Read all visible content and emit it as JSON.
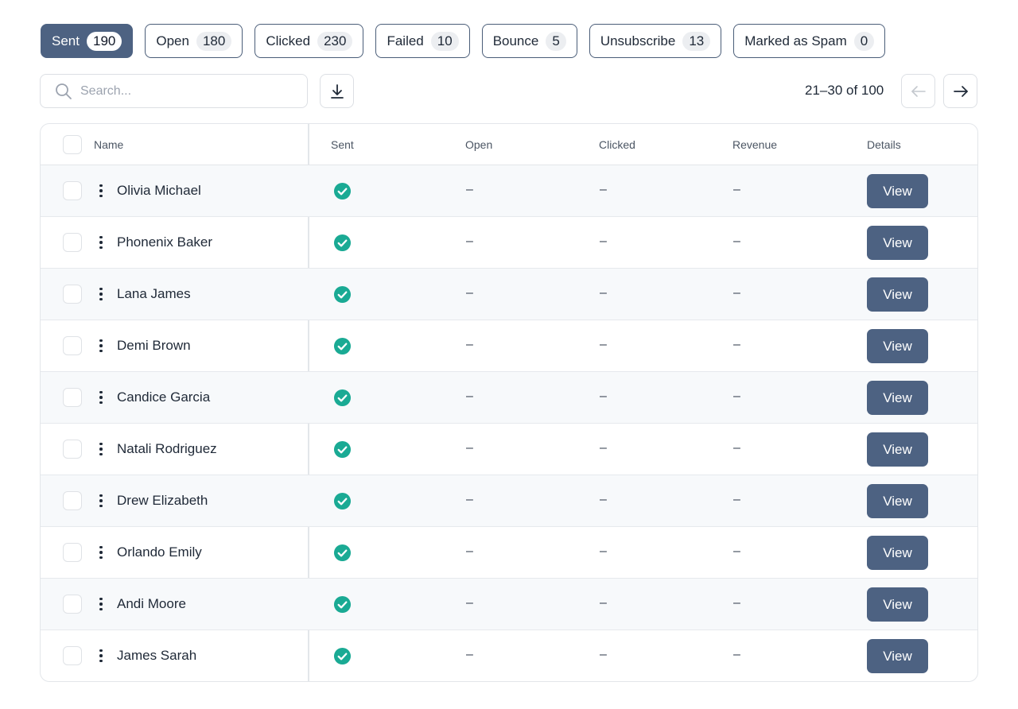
{
  "filters": [
    {
      "label": "Sent",
      "count": "190",
      "active": true
    },
    {
      "label": "Open",
      "count": "180"
    },
    {
      "label": "Clicked",
      "count": "230"
    },
    {
      "label": "Failed",
      "count": "10"
    },
    {
      "label": "Bounce",
      "count": "5"
    },
    {
      "label": "Unsubscribe",
      "count": "13"
    },
    {
      "label": "Marked as Spam",
      "count": "0"
    }
  ],
  "search": {
    "placeholder": "Search...",
    "value": "",
    "icon": "search-icon"
  },
  "toolbar": {
    "download_icon": "download-icon"
  },
  "pagination": {
    "range": "21–30 of 100",
    "prev_icon": "arrow-left-icon",
    "next_icon": "arrow-right-icon",
    "prev_disabled": true
  },
  "table": {
    "columns": [
      "Name",
      "Sent",
      "Open",
      "Clicked",
      "Revenue",
      "Details"
    ],
    "view_label": "View",
    "empty_value": "–",
    "sent_icon": "check-circle-icon",
    "colors": {
      "sent_check": "#1aaa94",
      "accent": "#4d6282"
    },
    "rows": [
      {
        "name": "Olivia Michael",
        "sent": true,
        "open": "–",
        "clicked": "–",
        "revenue": "–"
      },
      {
        "name": "Phonenix Baker",
        "sent": true,
        "open": "–",
        "clicked": "–",
        "revenue": "–"
      },
      {
        "name": "Lana James",
        "sent": true,
        "open": "–",
        "clicked": "–",
        "revenue": "–"
      },
      {
        "name": "Demi Brown",
        "sent": true,
        "open": "–",
        "clicked": "–",
        "revenue": "–"
      },
      {
        "name": "Candice Garcia",
        "sent": true,
        "open": "–",
        "clicked": "–",
        "revenue": "–"
      },
      {
        "name": "Natali Rodriguez",
        "sent": true,
        "open": "–",
        "clicked": "–",
        "revenue": "–"
      },
      {
        "name": "Drew Elizabeth",
        "sent": true,
        "open": "–",
        "clicked": "–",
        "revenue": "–"
      },
      {
        "name": "Orlando Emily",
        "sent": true,
        "open": "–",
        "clicked": "–",
        "revenue": "–"
      },
      {
        "name": "Andi Moore",
        "sent": true,
        "open": "–",
        "clicked": "–",
        "revenue": "–"
      },
      {
        "name": "James Sarah",
        "sent": true,
        "open": "–",
        "clicked": "–",
        "revenue": "–"
      }
    ]
  }
}
